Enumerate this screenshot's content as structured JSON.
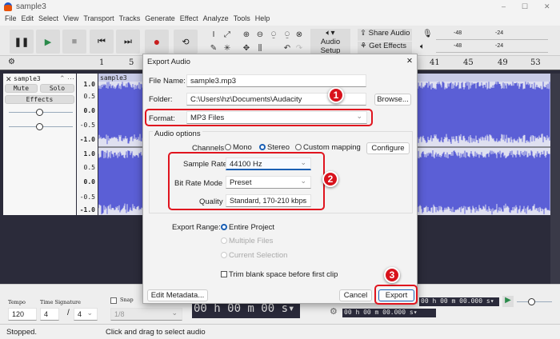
{
  "window": {
    "title": "sample3",
    "minimize": "–",
    "maximize": "☐",
    "close": "✕"
  },
  "menu": [
    "File",
    "Edit",
    "Select",
    "View",
    "Transport",
    "Tracks",
    "Generate",
    "Effect",
    "Analyze",
    "Tools",
    "Help"
  ],
  "toolbar": {
    "audio_setup": "Audio Setup",
    "share_audio": "Share Audio",
    "get_effects": "Get Effects",
    "meter_ticks": [
      "-48",
      "-24",
      "-48",
      "-24"
    ]
  },
  "ruler": {
    "ticks": [
      "1",
      "5",
      "41",
      "45",
      "49",
      "53"
    ]
  },
  "track": {
    "name": "sample3",
    "mute": "Mute",
    "solo": "Solo",
    "effects": "Effects",
    "clip_name": "sample3",
    "scale": [
      "1.0",
      "0.5",
      "0.0",
      "-0.5",
      "-1.0"
    ],
    "waveform_color": "#5b5fd6"
  },
  "bottom": {
    "tempo_label": "Tempo",
    "tempo": "120",
    "timesig_label": "Time Signature",
    "ts_num": "4",
    "ts_den": "4",
    "snap_label": "Snap",
    "snap_value": "1/8",
    "time": "00 h 00 m 00 s",
    "sel_start": "00 h 00 m 00.000 s",
    "sel_end": "00 h 00 m 00.000 s"
  },
  "status": {
    "state": "Stopped.",
    "hint": "Click and drag to select audio"
  },
  "dialog": {
    "title": "Export Audio",
    "close": "✕",
    "file_name_label": "File Name:",
    "file_name": "sample3.mp3",
    "folder_label": "Folder:",
    "folder": "C:\\Users\\hz\\Documents\\Audacity",
    "browse": "Browse...",
    "format_label": "Format:",
    "format": "MP3 Files",
    "audio_options": "Audio options",
    "channels_label": "Channels",
    "mono": "Mono",
    "stereo": "Stereo",
    "custom": "Custom mapping",
    "configure": "Configure",
    "sample_rate_label": "Sample Rate",
    "sample_rate": "44100 Hz",
    "bit_rate_mode_label": "Bit Rate Mode",
    "bit_rate_mode": "Preset",
    "quality_label": "Quality",
    "quality": "Standard, 170-210 kbps",
    "export_range_label": "Export Range:",
    "entire_project": "Entire Project",
    "multiple_files": "Multiple Files",
    "current_selection": "Current Selection",
    "trim": "Trim blank space before first clip",
    "edit_metadata": "Edit Metadata...",
    "cancel": "Cancel",
    "export": "Export"
  },
  "callouts": [
    "1",
    "2",
    "3"
  ],
  "colors": {
    "callout": "#d8121c",
    "accent": "#1a5fb4"
  }
}
